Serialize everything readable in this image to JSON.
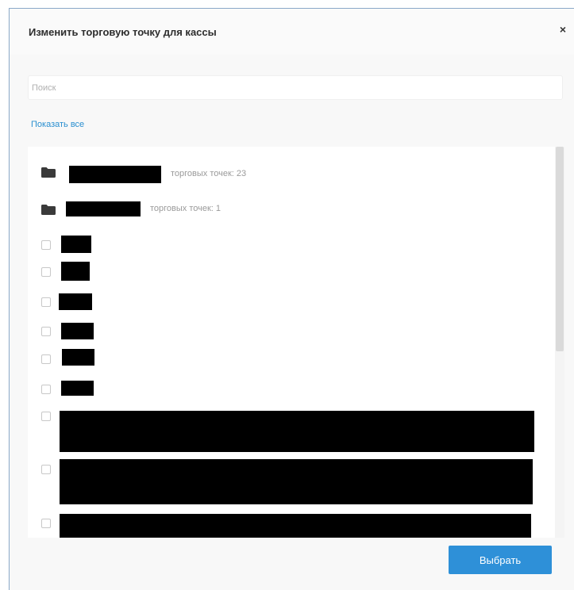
{
  "dialog": {
    "title": "Изменить торговую точку для кассы",
    "close_label": "×"
  },
  "search": {
    "placeholder": "Поиск",
    "value": ""
  },
  "show_all_label": "Показать все",
  "groups": [
    {
      "name": "",
      "count_text": "торговых точек: 23"
    },
    {
      "name": "",
      "count_text": "торговых точек: 1"
    }
  ],
  "items_count_visible": 9,
  "footer": {
    "select_label": "Выбрать"
  },
  "colors": {
    "accent": "#2e90d8",
    "link": "#2a8fd0"
  }
}
